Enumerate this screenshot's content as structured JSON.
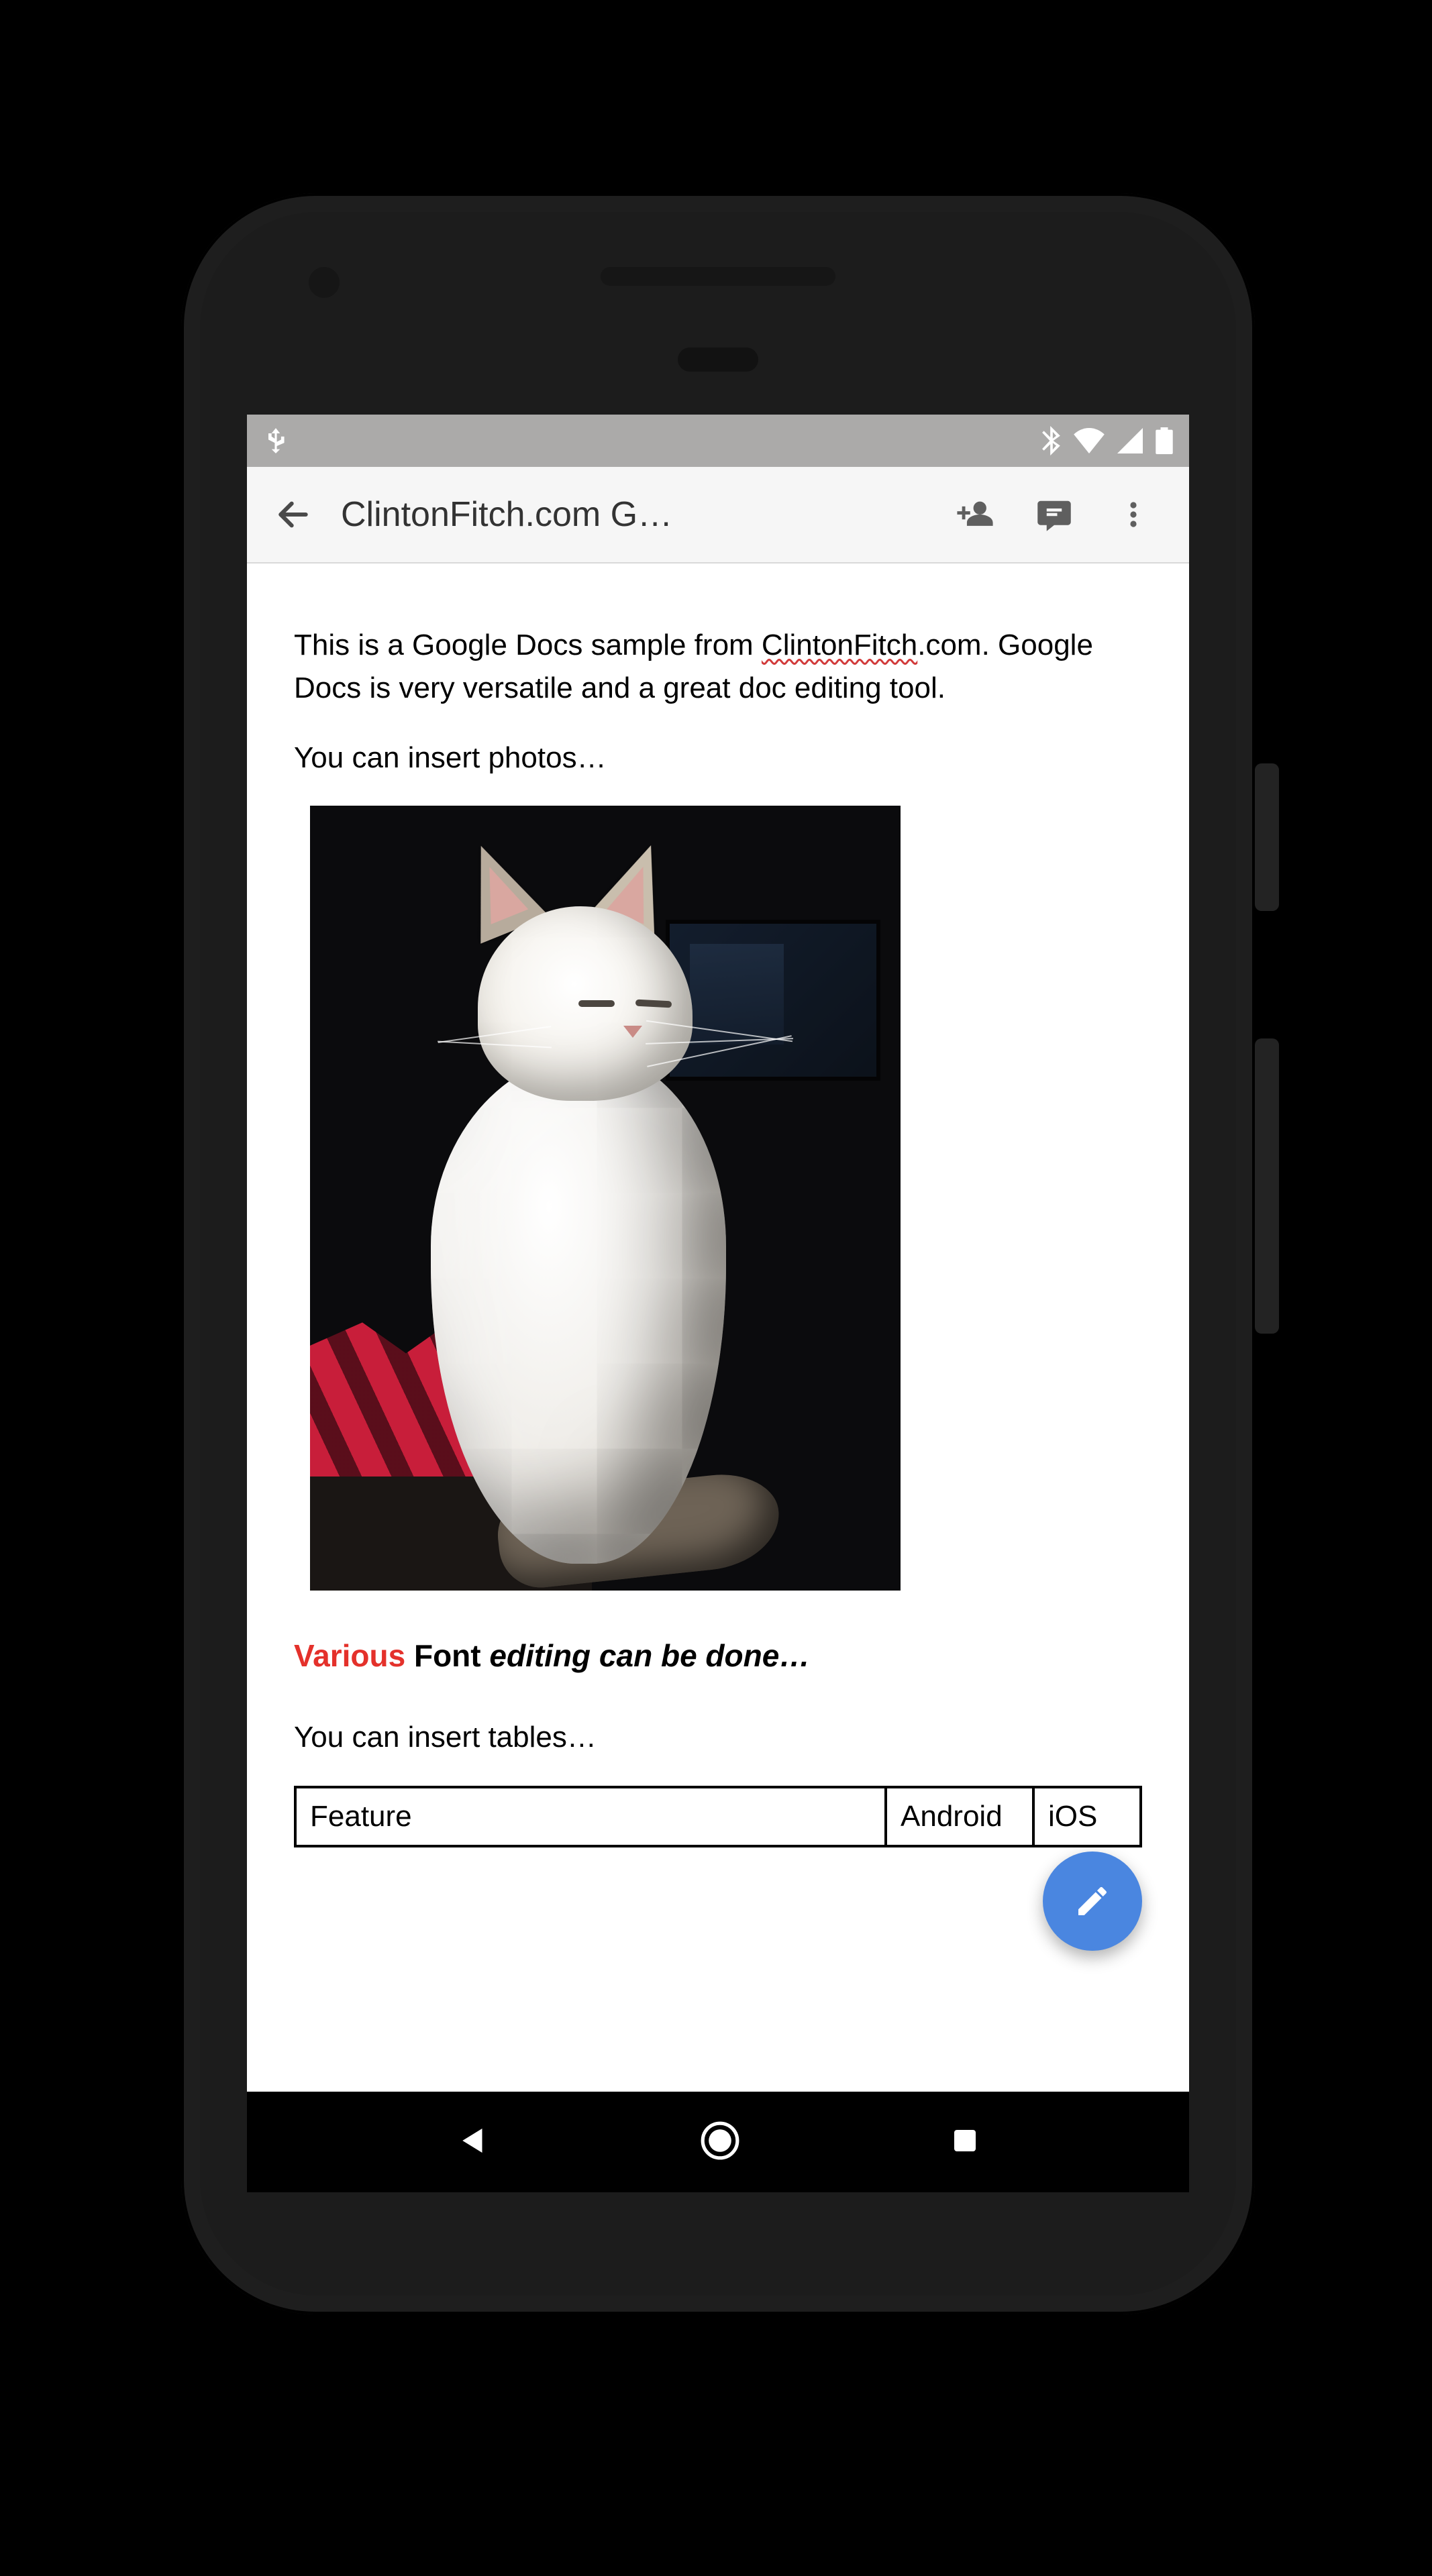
{
  "statusbar": {
    "icons": [
      "usb",
      "bluetooth",
      "wifi",
      "signal",
      "battery"
    ]
  },
  "appbar": {
    "title": "ClintonFitch.com G…",
    "actions": [
      "add-person",
      "comment",
      "overflow"
    ]
  },
  "doc": {
    "p1_a": "This is a Google Docs sample from ",
    "p1_squiggle": "ClintonFitch",
    "p1_b": ".com.  Google Docs is very versatile and a great doc editing tool.",
    "p2": "You can insert photos…",
    "formatted": {
      "w1": "Various",
      "w2": " Font ",
      "w3": "editing can be done…"
    },
    "p3": "You can insert tables…",
    "table": {
      "headers": [
        "Feature",
        "Android",
        "iOS"
      ]
    },
    "image_alt": "Photo of a white cat with grey ears sitting in sunlight"
  },
  "fab": {
    "label": "Edit"
  },
  "navbar": {
    "buttons": [
      "back",
      "home",
      "recent"
    ]
  },
  "colors": {
    "accent": "#4a86e0",
    "danger": "#e4312b"
  }
}
